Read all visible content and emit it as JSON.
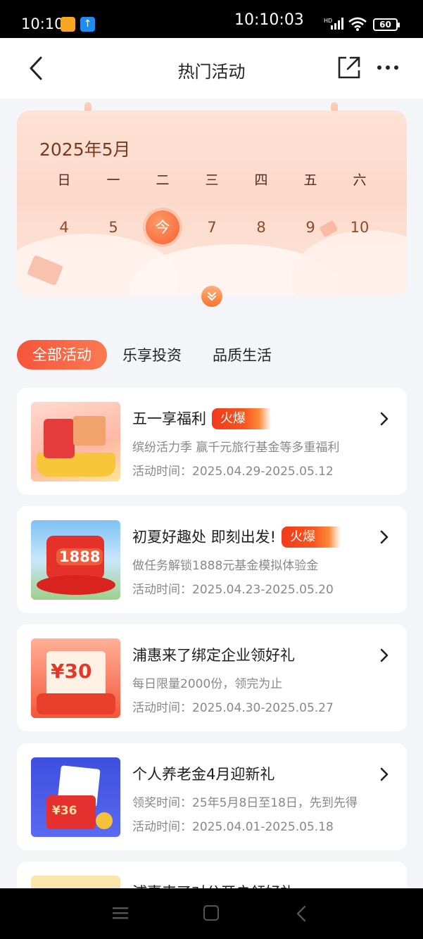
{
  "status_bar": {
    "time_left": "10:10",
    "clock": "10:10:03",
    "battery": "60",
    "signal_label": "HD"
  },
  "nav": {
    "title": "热门活动",
    "icons": [
      "back-icon",
      "share-icon",
      "more-icon"
    ]
  },
  "calendar": {
    "month": "2025年5月",
    "weekdays": [
      "日",
      "一",
      "二",
      "三",
      "四",
      "五",
      "六"
    ],
    "dates": [
      "4",
      "5",
      "今",
      "7",
      "8",
      "9",
      "10"
    ]
  },
  "tabs": [
    "全部活动",
    "乐享投资",
    "品质生活"
  ],
  "cards": [
    {
      "title": "五一享福利",
      "hot": "火爆",
      "desc": "缤纷活力季 赢千元旅行基金等多重福利",
      "time": "活动时间：2025.04.29-2025.05.12"
    },
    {
      "title": "初夏好趣处 即刻出发!",
      "hot": "火爆",
      "desc": "做任务解锁1888元基金模拟体验金",
      "time": "活动时间：2025.04.23-2025.05.20",
      "thumb_label": "1888"
    },
    {
      "title": "浦惠来了绑定企业领好礼",
      "desc": "每日限量2000份，领完为止",
      "time": "活动时间：2025.04.30-2025.05.27",
      "thumb_label": "¥30"
    },
    {
      "title": "个人养老金4月迎新礼",
      "desc": "领奖时间：25年5月8日至18日，先到先得",
      "time": "活动时间：2025.04.01-2025.05.18",
      "thumb_label": "¥36"
    },
    {
      "title": "浦惠来了对公开户领好礼"
    }
  ],
  "colors": {
    "accent": "#f5553a",
    "today": "#f4622e",
    "muted_text": "#888888",
    "background": "#f3f5f9"
  }
}
